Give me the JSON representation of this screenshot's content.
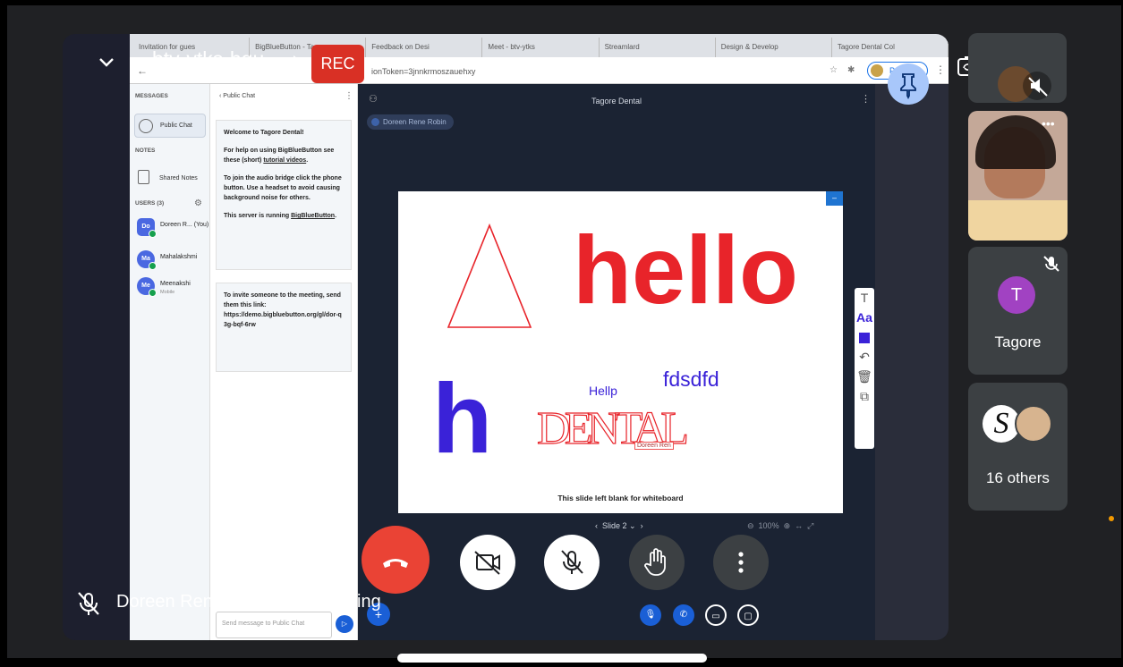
{
  "meeting": {
    "code": "btv-ytks-hqu",
    "rec_label": "REC",
    "presenting_text": "Doreen Rene Robin is presenting"
  },
  "browser": {
    "tabs": [
      "Invitation for gues",
      "BigBlueButton - Ta",
      "Feedback on Desi",
      "Meet - btv-ytks",
      "Streamlard",
      "Design & Develop",
      "Tagore Dental Col"
    ],
    "url_tail": "ionToken=3jnnkrmoszauehxy",
    "paused_label": "Paused"
  },
  "bbb": {
    "sidebar": {
      "messages_heading": "MESSAGES",
      "public_chat_label": "Public Chat",
      "notes_heading": "NOTES",
      "shared_notes_label": "Shared Notes",
      "users_heading": "USERS (3)",
      "users": [
        {
          "initials": "Do",
          "name": "Doreen R... (You)",
          "sub": ""
        },
        {
          "initials": "Ma",
          "name": "Mahalakshmi",
          "sub": ""
        },
        {
          "initials": "Me",
          "name": "Meenakshi",
          "sub": "Mobile"
        }
      ]
    },
    "chat": {
      "header": "Public Chat",
      "welcome": "Welcome to Tagore Dental!",
      "help_prefix": "For help on using BigBlueButton see these (short) ",
      "help_link": "tutorial videos",
      "audio_text": "To join the audio bridge click the phone button. Use a headset to avoid causing background noise for others.",
      "server_prefix": "This server is running ",
      "server_link": "BigBlueButton",
      "invite_text": "To invite someone to the meeting, send them this link:",
      "invite_link": "https://demo.bigbluebutton.org/gl/dor-q3g-bqf-6rw",
      "input_placeholder": "Send message to Public Chat"
    },
    "presentation": {
      "title": "Tagore Dental",
      "presenter_chip": "Doreen Rene Robin",
      "slide_footer": "This slide left blank for whiteboard",
      "slide_label": "Slide 2",
      "zoom": "100%",
      "drawn_text": {
        "hello": "hello",
        "h": "h",
        "hellp": "Hellp",
        "fdsdfd": "fdsdfd",
        "dental": "DENTAL",
        "cursor_tag": "Doreen Ren"
      }
    }
  },
  "participants": [
    {
      "name": "Tagore",
      "initial": "T",
      "color": "#a142c2"
    },
    {
      "name": "16 others",
      "initial": "S"
    }
  ],
  "colors": {
    "end_call": "#ea4335",
    "rec": "#d93025",
    "bbb_blue": "#1a5fd6",
    "pin": "#a8c7fa",
    "ink_red": "#e8242a",
    "ink_blue": "#3a22d8"
  }
}
